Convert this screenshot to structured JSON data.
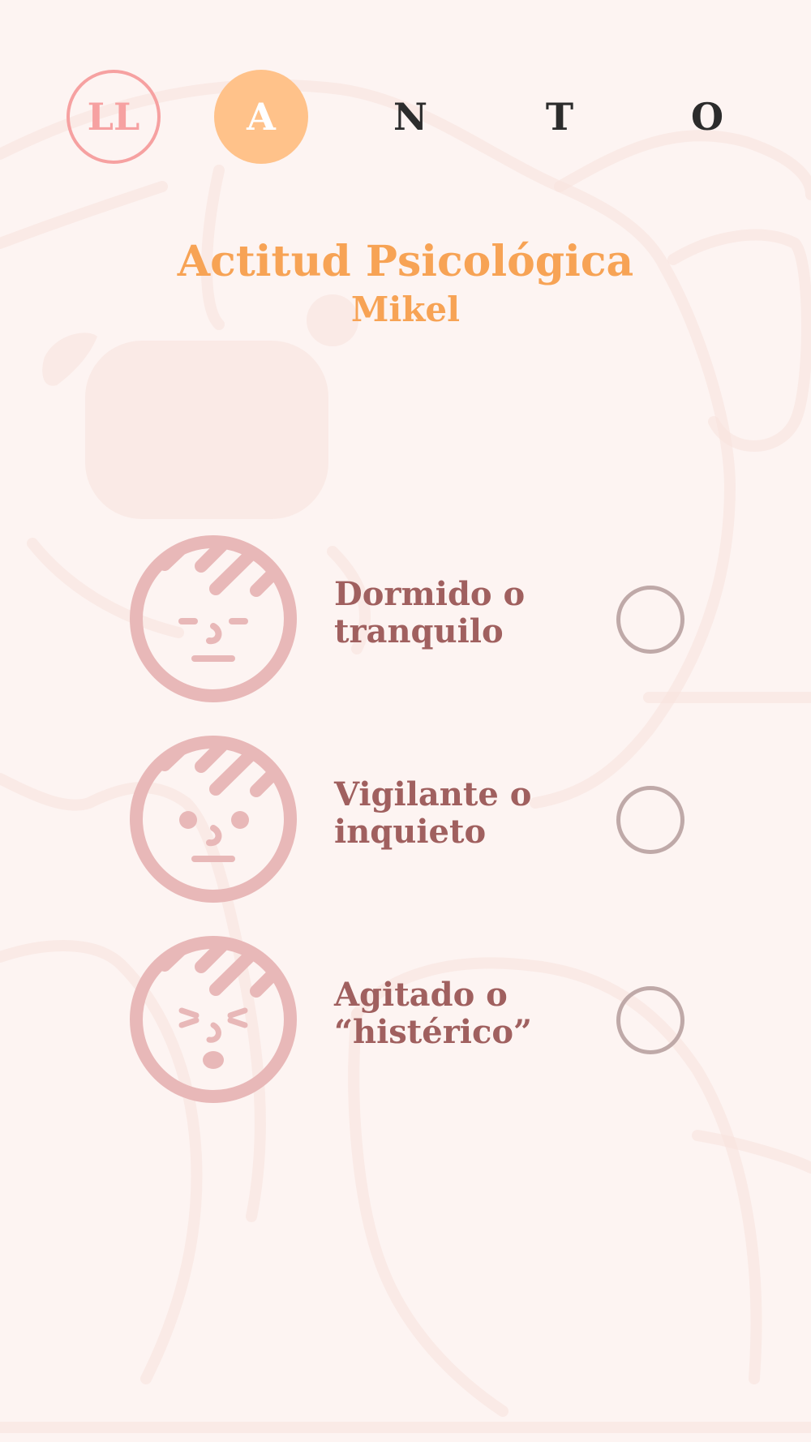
{
  "steps": [
    {
      "label": "LL",
      "state": "done"
    },
    {
      "label": "A",
      "state": "active"
    },
    {
      "label": "N",
      "state": "pending"
    },
    {
      "label": "T",
      "state": "pending"
    },
    {
      "label": "O",
      "state": "pending"
    }
  ],
  "header": {
    "title": "Actitud Psicológica",
    "subtitle": "Mikel"
  },
  "options": [
    {
      "label_line1": "Dormido o",
      "label_line2": "tranquilo",
      "icon": "sleeping-face-icon",
      "selected": false
    },
    {
      "label_line1": "Vigilante o",
      "label_line2": "inquieto",
      "icon": "alert-face-icon",
      "selected": false
    },
    {
      "label_line1": "Agitado o",
      "label_line2": "“histérico”",
      "icon": "agitated-face-icon",
      "selected": false
    }
  ],
  "colors": {
    "background": "#fdf4f2",
    "accent_orange": "#f7a355",
    "active_step": "#ffc28a",
    "done_step": "#f6a1a1",
    "option_text": "#a0605f",
    "face_icon": "#e8b8b8",
    "radio_border": "#bfa9a8"
  }
}
